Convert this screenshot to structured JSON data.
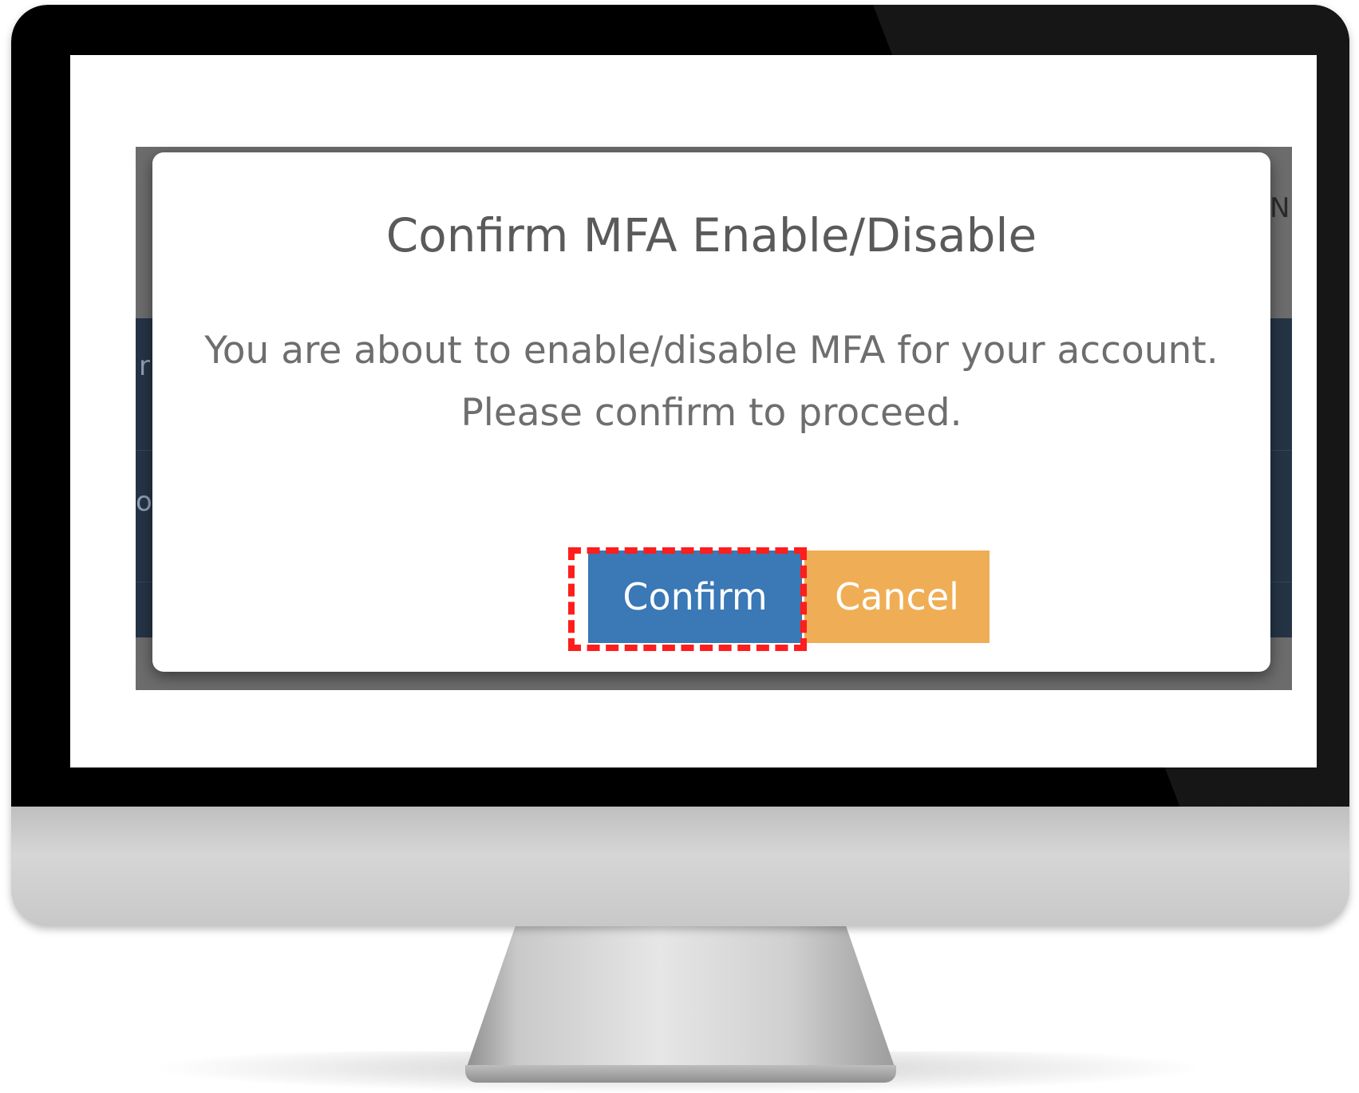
{
  "background_app": {
    "peek_right": "N",
    "peek_left_top": "r",
    "peek_left_bottom": "o",
    "colors": {
      "overlay": "#6c6c6c",
      "band": "#253445"
    }
  },
  "dialog": {
    "title": "Confirm MFA Enable/Disable",
    "message_line1": "You are about to enable/disable MFA for your account.",
    "message_line2": "Please confirm to proceed.",
    "confirm_label": "Confirm",
    "cancel_label": "Cancel",
    "confirm_highlighted": true,
    "colors": {
      "confirm": "#3a78b6",
      "cancel": "#efae55",
      "highlight": "#ff1d1d"
    }
  }
}
